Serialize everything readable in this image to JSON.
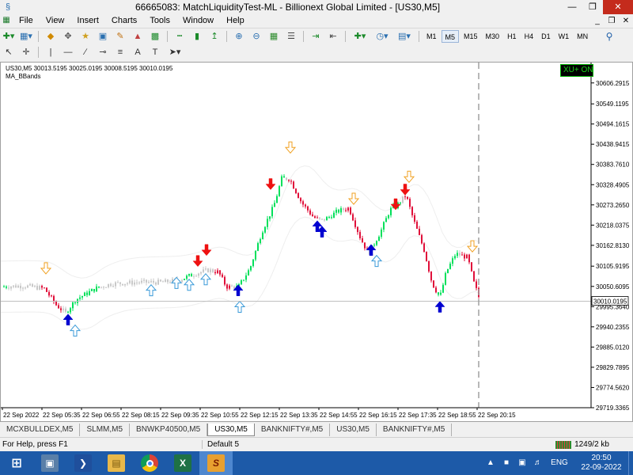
{
  "window": {
    "title": "66665083: MatchLiquidityTest-ML - Billionext Global Limited - [US30,M5]"
  },
  "menu": [
    "File",
    "View",
    "Insert",
    "Charts",
    "Tools",
    "Window",
    "Help"
  ],
  "timeframes": [
    "M1",
    "M5",
    "M15",
    "M30",
    "H1",
    "H4",
    "D1",
    "W1",
    "MN"
  ],
  "active_timeframe": "M5",
  "chart": {
    "info_line": "US30,M5  30013.5195 30025.0195 30008.5195 30010.0195",
    "indicator": "MA_BBands",
    "trade_badge": "XU+ ON",
    "current_price": "30010.0195",
    "colors": {
      "bull": "#00e05a",
      "bear": "#e0103a",
      "neutral": "#c8c8c8",
      "buy_arrow": "#0000d0",
      "sell_arrow": "#ee1111",
      "buy_outline": "#3a9ad8",
      "sell_outline": "#f0a020",
      "band": "#eeeeee"
    }
  },
  "chart_data": {
    "type": "candlestick",
    "ylim": [
      29719.3365,
      30662.0
    ],
    "price_ticks": [
      "30606.2915",
      "30549.1195",
      "30494.1615",
      "30438.9415",
      "30383.7610",
      "30328.4905",
      "30273.2650",
      "30218.0375",
      "30162.8130",
      "30105.9195",
      "30050.6095",
      "29995.3640",
      "29940.2355",
      "29885.0120",
      "29829.7895",
      "29774.5620",
      "29719.3365"
    ],
    "price_tick_values": [
      30606.2915,
      30549.1195,
      30494.1615,
      30438.9415,
      30383.761,
      30328.4905,
      30273.265,
      30218.0375,
      30162.813,
      30105.9195,
      30050.6095,
      29995.364,
      29940.2355,
      29885.012,
      29829.7895,
      29774.562,
      29719.3365
    ],
    "time_ticks": [
      "22 Sep 2022",
      "22 Sep 05:35",
      "22 Sep 06:55",
      "22 Sep 08:15",
      "22 Sep 09:35",
      "22 Sep 10:55",
      "22 Sep 12:15",
      "22 Sep 13:35",
      "22 Sep 14:55",
      "22 Sep 16:15",
      "22 Sep 17:35",
      "22 Sep 18:55",
      "22 Sep 20:15"
    ],
    "price_path": [
      [
        0,
        30050
      ],
      [
        30,
        30052
      ],
      [
        55,
        30045
      ],
      [
        70,
        30000
      ],
      [
        82,
        29978
      ],
      [
        95,
        30015
      ],
      [
        120,
        30045
      ],
      [
        140,
        30058
      ],
      [
        175,
        30062
      ],
      [
        205,
        30062
      ],
      [
        225,
        30068
      ],
      [
        245,
        30085
      ],
      [
        262,
        30095
      ],
      [
        275,
        30090
      ],
      [
        285,
        30050
      ],
      [
        300,
        30048
      ],
      [
        315,
        30100
      ],
      [
        330,
        30200
      ],
      [
        345,
        30270
      ],
      [
        355,
        30345
      ],
      [
        365,
        30345
      ],
      [
        380,
        30280
      ],
      [
        395,
        30240
      ],
      [
        405,
        30230
      ],
      [
        415,
        30240
      ],
      [
        425,
        30255
      ],
      [
        440,
        30265
      ],
      [
        455,
        30180
      ],
      [
        465,
        30140
      ],
      [
        480,
        30200
      ],
      [
        492,
        30260
      ],
      [
        500,
        30270
      ],
      [
        512,
        30300
      ],
      [
        522,
        30230
      ],
      [
        535,
        30150
      ],
      [
        545,
        30060
      ],
      [
        555,
        30020
      ],
      [
        563,
        30090
      ],
      [
        575,
        30140
      ],
      [
        590,
        30130
      ],
      [
        598,
        30060
      ],
      [
        606,
        30010
      ]
    ],
    "signals": [
      {
        "type": "sell_outline",
        "time_x": 57,
        "price": 30100
      },
      {
        "type": "buy_solid",
        "time_x": 85,
        "price": 29960
      },
      {
        "type": "buy_outline",
        "time_x": 94,
        "price": 29930
      },
      {
        "type": "buy_outline",
        "time_x": 190,
        "price": 30040
      },
      {
        "type": "buy_outline",
        "time_x": 222,
        "price": 30060
      },
      {
        "type": "buy_outline",
        "time_x": 238,
        "price": 30055
      },
      {
        "type": "buy_outline",
        "time_x": 259,
        "price": 30070
      },
      {
        "type": "sell_solid",
        "time_x": 249,
        "price": 30120
      },
      {
        "type": "sell_solid",
        "time_x": 260,
        "price": 30150
      },
      {
        "type": "buy_solid",
        "time_x": 300,
        "price": 30040
      },
      {
        "type": "buy_outline",
        "time_x": 302,
        "price": 29995
      },
      {
        "type": "sell_solid",
        "time_x": 341,
        "price": 30330
      },
      {
        "type": "sell_outline",
        "time_x": 366,
        "price": 30430
      },
      {
        "type": "buy_solid",
        "time_x": 400,
        "price": 30215
      },
      {
        "type": "buy_solid",
        "time_x": 406,
        "price": 30200
      },
      {
        "type": "sell_outline",
        "time_x": 446,
        "price": 30290
      },
      {
        "type": "buy_solid",
        "time_x": 468,
        "price": 30150
      },
      {
        "type": "buy_outline",
        "time_x": 475,
        "price": 30120
      },
      {
        "type": "sell_solid",
        "time_x": 499,
        "price": 30275
      },
      {
        "type": "sell_solid",
        "time_x": 511,
        "price": 30315
      },
      {
        "type": "sell_outline",
        "time_x": 516,
        "price": 30350
      },
      {
        "type": "buy_solid",
        "time_x": 555,
        "price": 29995
      },
      {
        "type": "sell_outline",
        "time_x": 596,
        "price": 30160
      }
    ]
  },
  "tabs": [
    "MCXBULLDEX,M5",
    "SLMM,M5",
    "BNWKP40500,M5",
    "US30,M5",
    "BANKNIFTY#,M5",
    "US30,M5",
    "BANKNIFTY#,M5"
  ],
  "active_tab": "US30,M5",
  "status": {
    "help": "For Help, press F1",
    "profile": "Default 5",
    "traffic": "1249/2 kb"
  },
  "taskbar": {
    "lang": "ENG",
    "time": "20:50",
    "date": "22-09-2022"
  }
}
